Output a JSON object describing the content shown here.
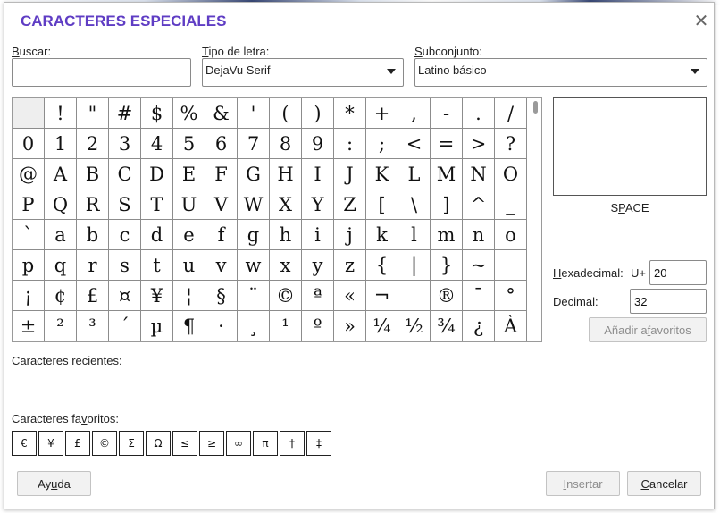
{
  "dialog": {
    "title": "CARACTERES ESPECIALES",
    "close_glyph": "✕"
  },
  "search": {
    "label_first": "B",
    "label_rest": "uscar:",
    "value": ""
  },
  "font": {
    "label_first": "T",
    "label_rest": "ipo de letra:",
    "selected": "DejaVu Serif"
  },
  "subset": {
    "label_first": "S",
    "label_rest": "ubconjunto:",
    "selected": "Latino básico"
  },
  "grid": {
    "selected_index": 0,
    "chars": [
      " ",
      "!",
      "\"",
      "#",
      "$",
      "%",
      "&",
      "'",
      "(",
      ")",
      "*",
      "+",
      ",",
      "-",
      ".",
      "/",
      "0",
      "1",
      "2",
      "3",
      "4",
      "5",
      "6",
      "7",
      "8",
      "9",
      ":",
      ";",
      "<",
      "=",
      ">",
      "?",
      "@",
      "A",
      "B",
      "C",
      "D",
      "E",
      "F",
      "G",
      "H",
      "I",
      "J",
      "K",
      "L",
      "M",
      "N",
      "O",
      "P",
      "Q",
      "R",
      "S",
      "T",
      "U",
      "V",
      "W",
      "X",
      "Y",
      "Z",
      "[",
      "\\",
      "]",
      "^",
      "_",
      "`",
      "a",
      "b",
      "c",
      "d",
      "e",
      "f",
      "g",
      "h",
      "i",
      "j",
      "k",
      "l",
      "m",
      "n",
      "o",
      "p",
      "q",
      "r",
      "s",
      "t",
      "u",
      "v",
      "w",
      "x",
      "y",
      "z",
      "{",
      "|",
      "}",
      "~",
      " ",
      "¡",
      "¢",
      "£",
      "¤",
      "¥",
      "¦",
      "§",
      "¨",
      "©",
      "ª",
      "«",
      "¬",
      " ",
      "®",
      "¯",
      "°",
      "±",
      "²",
      "³",
      "´",
      "µ",
      "¶",
      "·",
      "¸",
      "¹",
      "º",
      "»",
      "¼",
      "½",
      "¾",
      "¿",
      "À"
    ]
  },
  "preview": {
    "char": " ",
    "name_pre": "S",
    "name_u": "P",
    "name_post": "ACE"
  },
  "hex": {
    "label_first": "H",
    "label_rest": "exadecimal:",
    "prefix": "U+",
    "value": "20"
  },
  "decimal": {
    "label_first": "D",
    "label_rest": "ecimal:",
    "value": "32"
  },
  "add_favorites": {
    "label_pre": "Añadir a ",
    "label_u": "f",
    "label_post": "avoritos"
  },
  "recent": {
    "label_pre": "Caracteres ",
    "label_u": "r",
    "label_post": "ecientes:"
  },
  "favorites": {
    "label_pre": "Caracteres fa",
    "label_u": "v",
    "label_post": "oritos:",
    "chars": [
      "€",
      "¥",
      "£",
      "©",
      "Σ",
      "Ω",
      "≤",
      "≥",
      "∞",
      "π",
      "†",
      "‡"
    ]
  },
  "buttons": {
    "help_pre": "Ay",
    "help_u": "u",
    "help_post": "da",
    "insert_first": "I",
    "insert_rest": "nsertar",
    "cancel_first": "C",
    "cancel_rest": "ancelar"
  }
}
